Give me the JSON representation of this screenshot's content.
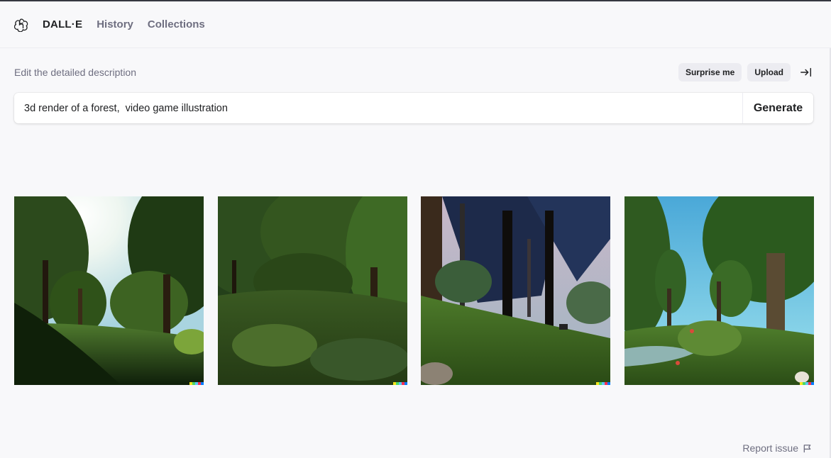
{
  "nav": {
    "brand": "DALL·E",
    "links": [
      "History",
      "Collections"
    ]
  },
  "editor": {
    "label": "Edit the detailed description",
    "surprise_label": "Surprise me",
    "upload_label": "Upload",
    "prompt_value": "3d render of a forest,  video game illustration",
    "generate_label": "Generate"
  },
  "results": {
    "images": [
      {
        "scene": "sunlit-forest"
      },
      {
        "scene": "dense-green-forest"
      },
      {
        "scene": "pine-forest-dusk"
      },
      {
        "scene": "forest-stream"
      }
    ]
  },
  "footer": {
    "report_label": "Report issue"
  },
  "colors": {
    "accent_dark": "#202123",
    "muted_text": "#6e6e80",
    "pill_bg": "#ececf1",
    "signature": [
      "#f8e71c",
      "#4cd964",
      "#5ac8fa",
      "#ff2d55",
      "#007aff"
    ]
  }
}
